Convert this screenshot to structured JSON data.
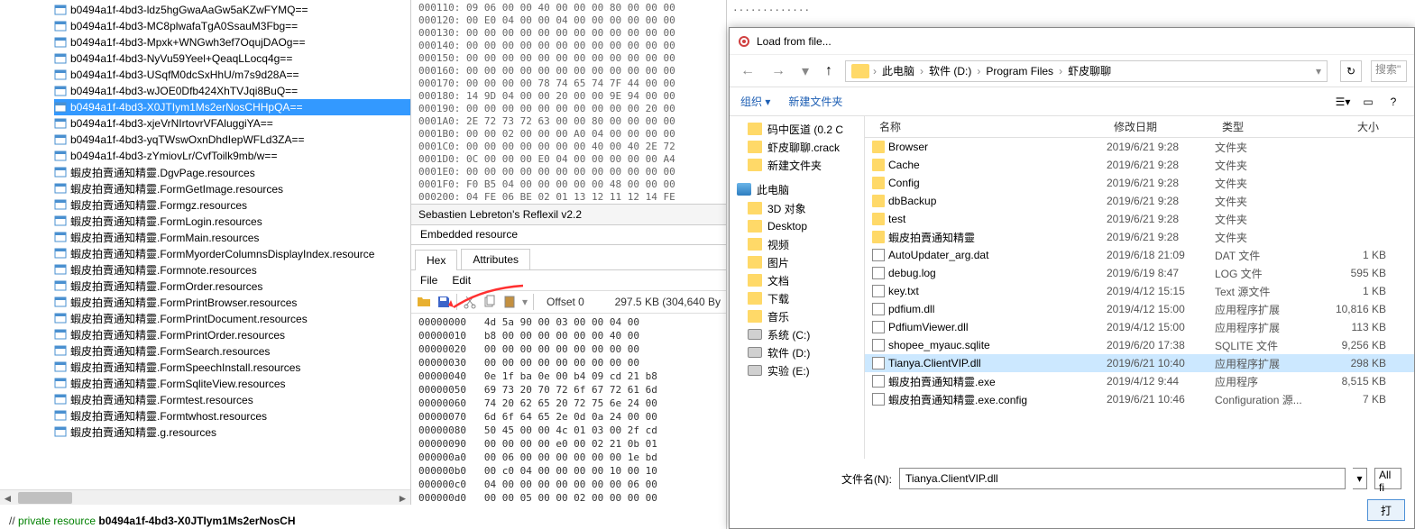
{
  "tree": {
    "items": [
      {
        "label": "b0494a1f-4bd3-ldz5hgGwaAaGw5aKZwFYMQ==",
        "sel": false
      },
      {
        "label": "b0494a1f-4bd3-MC8plwafaTgA0SsauM3Fbg==",
        "sel": false
      },
      {
        "label": "b0494a1f-4bd3-Mpxk+WNGwh3ef7OqujDAOg==",
        "sel": false
      },
      {
        "label": "b0494a1f-4bd3-NyVu59Yeel+QeaqLLocq4g==",
        "sel": false
      },
      {
        "label": "b0494a1f-4bd3-USqfM0dcSxHhU/m7s9d28A==",
        "sel": false
      },
      {
        "label": "b0494a1f-4bd3-wJOE0Dfb424XhTVJqi8BuQ==",
        "sel": false
      },
      {
        "label": "b0494a1f-4bd3-X0JTIym1Ms2erNosCHHpQA==",
        "sel": true
      },
      {
        "label": "b0494a1f-4bd3-xjeVrNIrtovrVFAluggiYA==",
        "sel": false
      },
      {
        "label": "b0494a1f-4bd3-yqTWswOxnDhdIepWFLd3ZA==",
        "sel": false
      },
      {
        "label": "b0494a1f-4bd3-zYmiovLr/CvfToilk9mb/w==",
        "sel": false
      },
      {
        "label": "蝦皮拍賣通知精靈.DgvPage.resources",
        "sel": false
      },
      {
        "label": "蝦皮拍賣通知精靈.FormGetImage.resources",
        "sel": false
      },
      {
        "label": "蝦皮拍賣通知精靈.Formgz.resources",
        "sel": false
      },
      {
        "label": "蝦皮拍賣通知精靈.FormLogin.resources",
        "sel": false
      },
      {
        "label": "蝦皮拍賣通知精靈.FormMain.resources",
        "sel": false
      },
      {
        "label": "蝦皮拍賣通知精靈.FormMyorderColumnsDisplayIndex.resource",
        "sel": false
      },
      {
        "label": "蝦皮拍賣通知精靈.Formnote.resources",
        "sel": false
      },
      {
        "label": "蝦皮拍賣通知精靈.FormOrder.resources",
        "sel": false
      },
      {
        "label": "蝦皮拍賣通知精靈.FormPrintBrowser.resources",
        "sel": false
      },
      {
        "label": "蝦皮拍賣通知精靈.FormPrintDocument.resources",
        "sel": false
      },
      {
        "label": "蝦皮拍賣通知精靈.FormPrintOrder.resources",
        "sel": false
      },
      {
        "label": "蝦皮拍賣通知精靈.FormSearch.resources",
        "sel": false
      },
      {
        "label": "蝦皮拍賣通知精靈.FormSpeechInstall.resources",
        "sel": false
      },
      {
        "label": "蝦皮拍賣通知精靈.FormSqliteView.resources",
        "sel": false
      },
      {
        "label": "蝦皮拍賣通知精靈.Formtest.resources",
        "sel": false
      },
      {
        "label": "蝦皮拍賣通知精靈.Formtwhost.resources",
        "sel": false
      },
      {
        "label": "蝦皮拍賣通知精靈.g.resources",
        "sel": false
      }
    ]
  },
  "bottom_comment_prefix": "// ",
  "bottom_comment_priv": "private resource ",
  "bottom_comment_name": "b0494a1f-4bd3-X0JTIym1Ms2erNosCH",
  "hex_top": "000110: 09 06 00 00 40 00 00 00 80 00 00 00\n000120: 00 E0 04 00 00 04 00 00 00 00 00 00\n000130: 00 00 00 00 00 00 00 00 00 00 00 00\n000140: 00 00 00 00 00 00 00 00 00 00 00 00\n000150: 00 00 00 00 00 00 00 00 00 00 00 00\n000160: 00 00 00 00 00 00 00 00 00 00 00 00\n000170: 00 00 00 00 78 74 65 74 7F 44 00 00\n000180: 14 9D 04 00 00 20 00 00 9E 94 00 00\n000190: 00 00 00 00 00 00 00 00 00 00 20 00\n0001A0: 2E 72 73 72 63 00 00 80 00 00 00 00\n0001B0: 00 00 02 00 00 00 A0 04 00 00 00 00\n0001C0: 00 00 00 00 00 00 00 40 00 40 2E 72\n0001D0: 0C 00 00 00 E0 04 00 00 00 00 00 A4\n0001E0: 00 00 00 00 00 00 00 00 00 00 00 00\n0001F0: F0 B5 04 00 00 00 00 00 48 00 00 00\n000200: 04 FE 06 BE 02 01 13 12 11 12 14 FE",
  "reflexil_title": "Sebastien Lebreton's Reflexil v2.2",
  "embedded_title": "Embedded resource",
  "tabs": {
    "hex": "Hex",
    "attr": "Attributes"
  },
  "menu": {
    "file": "File",
    "edit": "Edit"
  },
  "toolbar_offset": "Offset 0",
  "toolbar_size": "297.5 KB (304,640 By",
  "hex_body": "00000000   4d 5a 90 00 03 00 00 04 00\n00000010   b8 00 00 00 00 00 00 40 00\n00000020   00 00 00 00 00 00 00 00 00\n00000030   00 00 00 00 00 00 00 00 00\n00000040   0e 1f ba 0e 00 b4 09 cd 21 b8\n00000050   69 73 20 70 72 6f 67 72 61 6d\n00000060   74 20 62 65 20 72 75 6e 24 00\n00000070   6d 6f 64 65 2e 0d 0a 24 00 00\n00000080   50 45 00 00 4c 01 03 00 2f cd\n00000090   00 00 00 00 e0 00 02 21 0b 01\n000000a0   00 06 00 00 00 00 00 00 1e bd\n000000b0   00 c0 04 00 00 00 00 10 00 10\n000000c0   04 00 00 00 00 00 00 00 06 00\n000000d0   00 00 05 00 00 02 00 00 00 00",
  "dots_preview": ".............",
  "dialog": {
    "title": "Load from file...",
    "breadcrumb": [
      "此电脑",
      "软件 (D:)",
      "Program Files",
      "虾皮聊聊"
    ],
    "search_placeholder": "搜索\"",
    "toolbar": {
      "org": "组织",
      "new_folder": "新建文件夹"
    },
    "sidebar": {
      "quick": [
        {
          "label": "码中医道 (0.2 C"
        },
        {
          "label": "虾皮聊聊.crack"
        },
        {
          "label": "新建文件夹"
        }
      ],
      "pc_label": "此电脑",
      "pc": [
        {
          "label": "3D 对象",
          "icon": "obj"
        },
        {
          "label": "Desktop",
          "icon": "desktop"
        },
        {
          "label": "视频",
          "icon": "video"
        },
        {
          "label": "图片",
          "icon": "picture"
        },
        {
          "label": "文档",
          "icon": "doc"
        },
        {
          "label": "下载",
          "icon": "download"
        },
        {
          "label": "音乐",
          "icon": "music"
        },
        {
          "label": "系统 (C:)",
          "icon": "drive"
        },
        {
          "label": "软件 (D:)",
          "icon": "drive"
        },
        {
          "label": "实验 (E:)",
          "icon": "drive"
        }
      ]
    },
    "columns": {
      "name": "名称",
      "date": "修改日期",
      "type": "类型",
      "size": "大小"
    },
    "files": [
      {
        "name": "Browser",
        "date": "2019/6/21 9:28",
        "type": "文件夹",
        "size": "",
        "icon": "folder"
      },
      {
        "name": "Cache",
        "date": "2019/6/21 9:28",
        "type": "文件夹",
        "size": "",
        "icon": "folder"
      },
      {
        "name": "Config",
        "date": "2019/6/21 9:28",
        "type": "文件夹",
        "size": "",
        "icon": "folder"
      },
      {
        "name": "dbBackup",
        "date": "2019/6/21 9:28",
        "type": "文件夹",
        "size": "",
        "icon": "folder"
      },
      {
        "name": "test",
        "date": "2019/6/21 9:28",
        "type": "文件夹",
        "size": "",
        "icon": "folder"
      },
      {
        "name": "蝦皮拍賣通知精靈",
        "date": "2019/6/21 9:28",
        "type": "文件夹",
        "size": "",
        "icon": "folder"
      },
      {
        "name": "AutoUpdater_arg.dat",
        "date": "2019/6/18 21:09",
        "type": "DAT 文件",
        "size": "1 KB",
        "icon": "dat"
      },
      {
        "name": "debug.log",
        "date": "2019/6/19 8:47",
        "type": "LOG 文件",
        "size": "595 KB",
        "icon": "file"
      },
      {
        "name": "key.txt",
        "date": "2019/4/12 15:15",
        "type": "Text 源文件",
        "size": "1 KB",
        "icon": "file"
      },
      {
        "name": "pdfium.dll",
        "date": "2019/4/12 15:00",
        "type": "应用程序扩展",
        "size": "10,816 KB",
        "icon": "dll"
      },
      {
        "name": "PdfiumViewer.dll",
        "date": "2019/4/12 15:00",
        "type": "应用程序扩展",
        "size": "113 KB",
        "icon": "dll"
      },
      {
        "name": "shopee_myauc.sqlite",
        "date": "2019/6/20 17:38",
        "type": "SQLITE 文件",
        "size": "9,256 KB",
        "icon": "file"
      },
      {
        "name": "Tianya.ClientVIP.dll",
        "date": "2019/6/21 10:40",
        "type": "应用程序扩展",
        "size": "298 KB",
        "icon": "dll",
        "selected": true
      },
      {
        "name": "蝦皮拍賣通知精靈.exe",
        "date": "2019/4/12 9:44",
        "type": "应用程序",
        "size": "8,515 KB",
        "icon": "exe"
      },
      {
        "name": "蝦皮拍賣通知精靈.exe.config",
        "date": "2019/6/21 10:46",
        "type": "Configuration 源...",
        "size": "7 KB",
        "icon": "file"
      }
    ],
    "filename_label": "文件名(N):",
    "filename_value": "Tianya.ClientVIP.dll",
    "filter": "All fi",
    "open_btn": "打"
  }
}
